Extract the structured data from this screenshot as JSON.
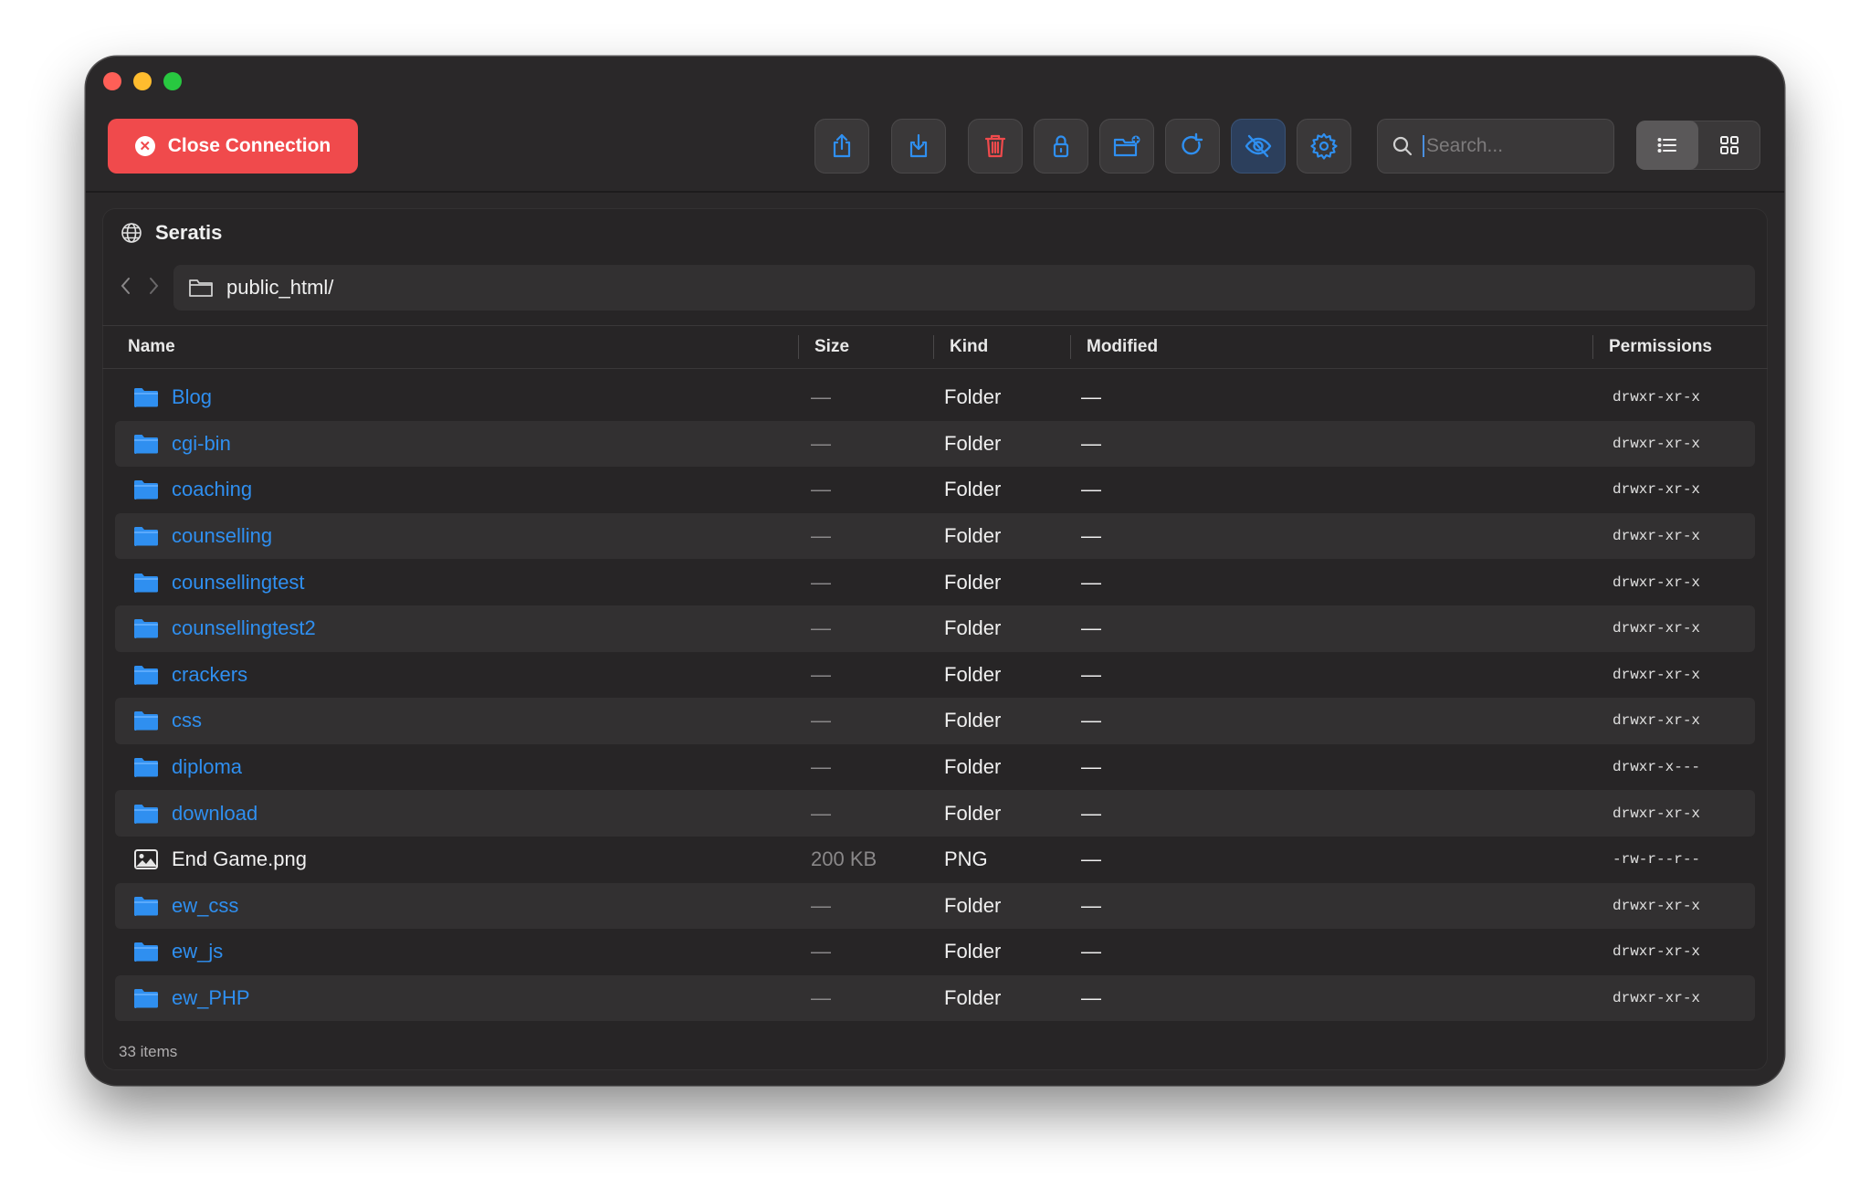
{
  "window": {
    "title": ""
  },
  "toolbar": {
    "close_connection_label": "Close Connection",
    "buttons": [
      {
        "icon": "upload-icon",
        "color": "#2f8ff0"
      },
      {
        "icon": "download-icon",
        "color": "#2f8ff0"
      },
      {
        "icon": "trash-icon",
        "color": "#f04a4c"
      },
      {
        "icon": "lock-icon",
        "color": "#2f8ff0"
      },
      {
        "icon": "new-folder-icon",
        "color": "#2f8ff0"
      },
      {
        "icon": "refresh-icon",
        "color": "#2f8ff0"
      },
      {
        "icon": "eye-slash-icon",
        "color": "#2f8ff0",
        "active": true
      },
      {
        "icon": "gear-icon",
        "color": "#2f8ff0"
      }
    ],
    "search_placeholder": "Search...",
    "view_mode": "list"
  },
  "server": {
    "name": "Seratis"
  },
  "path": {
    "current": "public_html/"
  },
  "columns": {
    "name": "Name",
    "size": "Size",
    "kind": "Kind",
    "modified": "Modified",
    "permissions": "Permissions"
  },
  "files": [
    {
      "name": "Blog",
      "type": "folder",
      "size": "—",
      "kind": "Folder",
      "modified": "—",
      "permissions": "drwxr-xr-x"
    },
    {
      "name": "cgi-bin",
      "type": "folder",
      "size": "—",
      "kind": "Folder",
      "modified": "—",
      "permissions": "drwxr-xr-x"
    },
    {
      "name": "coaching",
      "type": "folder",
      "size": "—",
      "kind": "Folder",
      "modified": "—",
      "permissions": "drwxr-xr-x"
    },
    {
      "name": "counselling",
      "type": "folder",
      "size": "—",
      "kind": "Folder",
      "modified": "—",
      "permissions": "drwxr-xr-x"
    },
    {
      "name": "counsellingtest",
      "type": "folder",
      "size": "—",
      "kind": "Folder",
      "modified": "—",
      "permissions": "drwxr-xr-x"
    },
    {
      "name": "counsellingtest2",
      "type": "folder",
      "size": "—",
      "kind": "Folder",
      "modified": "—",
      "permissions": "drwxr-xr-x"
    },
    {
      "name": "crackers",
      "type": "folder",
      "size": "—",
      "kind": "Folder",
      "modified": "—",
      "permissions": "drwxr-xr-x"
    },
    {
      "name": "css",
      "type": "folder",
      "size": "—",
      "kind": "Folder",
      "modified": "—",
      "permissions": "drwxr-xr-x"
    },
    {
      "name": "diploma",
      "type": "folder",
      "size": "—",
      "kind": "Folder",
      "modified": "—",
      "permissions": "drwxr-x---"
    },
    {
      "name": "download",
      "type": "folder",
      "size": "—",
      "kind": "Folder",
      "modified": "—",
      "permissions": "drwxr-xr-x"
    },
    {
      "name": "End Game.png",
      "type": "image",
      "size": "200 KB",
      "kind": "PNG",
      "modified": "—",
      "permissions": "-rw-r--r--"
    },
    {
      "name": "ew_css",
      "type": "folder",
      "size": "—",
      "kind": "Folder",
      "modified": "—",
      "permissions": "drwxr-xr-x"
    },
    {
      "name": "ew_js",
      "type": "folder",
      "size": "—",
      "kind": "Folder",
      "modified": "—",
      "permissions": "drwxr-xr-x"
    },
    {
      "name": "ew_PHP",
      "type": "folder",
      "size": "—",
      "kind": "Folder",
      "modified": "—",
      "permissions": "drwxr-xr-x"
    }
  ],
  "status": {
    "item_count": "33 items"
  },
  "colors": {
    "accent": "#2f8ff0",
    "danger": "#f04a4c",
    "background": "#2a2829"
  }
}
